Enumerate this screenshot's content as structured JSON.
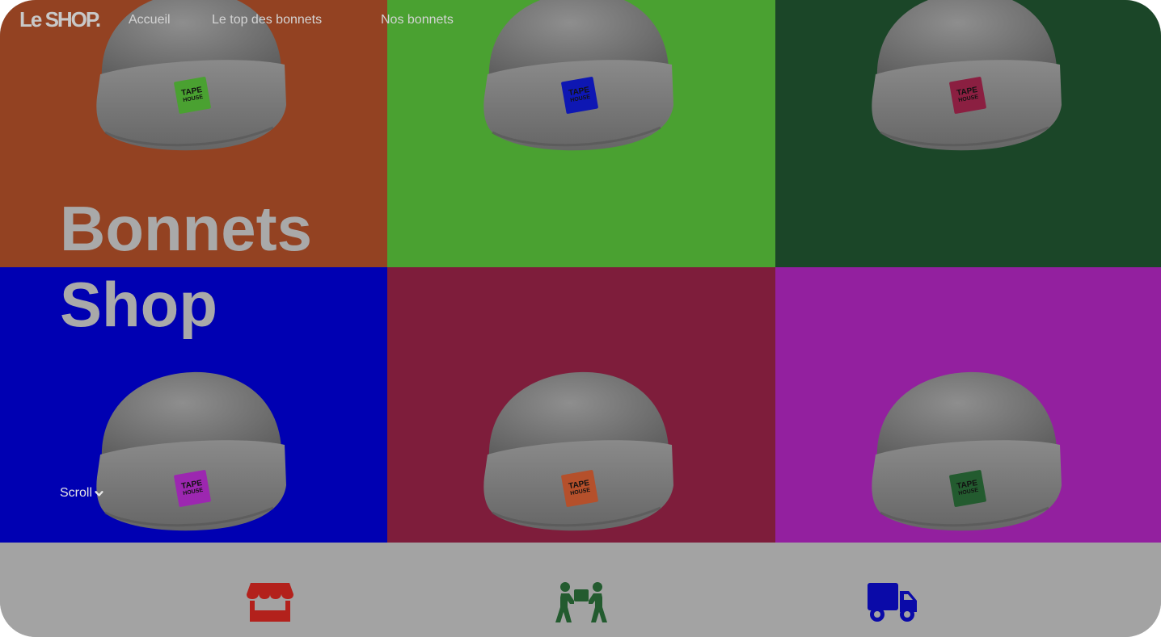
{
  "nav": {
    "logo": "Le SHOP.",
    "links": [
      "Accueil",
      "Le top des bonnets",
      "Nos bonnets"
    ]
  },
  "hero": {
    "title_line1": "Bonnets",
    "title_line2": "Shop",
    "scroll_label": "Scroll"
  },
  "tiles": [
    {
      "bg": "#934222",
      "patch": "#4aa131",
      "patch_text": [
        "TAPE",
        "HOUSE"
      ]
    },
    {
      "bg": "#4aa131",
      "patch": "#0e17b3",
      "patch_text": [
        "TAPE",
        "HOUSE"
      ]
    },
    {
      "bg": "#1b4628",
      "patch": "#8b1f41",
      "patch_text": [
        "TAPE",
        "HOUSE"
      ]
    },
    {
      "bg": "#0000b2",
      "patch": "#9c27b0",
      "patch_text": [
        "TAPE",
        "HOUSE"
      ]
    },
    {
      "bg": "#7e1d3b",
      "patch": "#b5502b",
      "patch_text": [
        "TAPE",
        "HOUSE"
      ]
    },
    {
      "bg": "#93209f",
      "patch": "#235b2f",
      "patch_text": [
        "TAPE",
        "HOUSE"
      ]
    }
  ],
  "features": [
    {
      "icon": "store-icon",
      "color": "#b3211c"
    },
    {
      "icon": "people-carry-box-icon",
      "color": "#235b2f"
    },
    {
      "icon": "truck-icon",
      "color": "#0a0aa8"
    }
  ]
}
